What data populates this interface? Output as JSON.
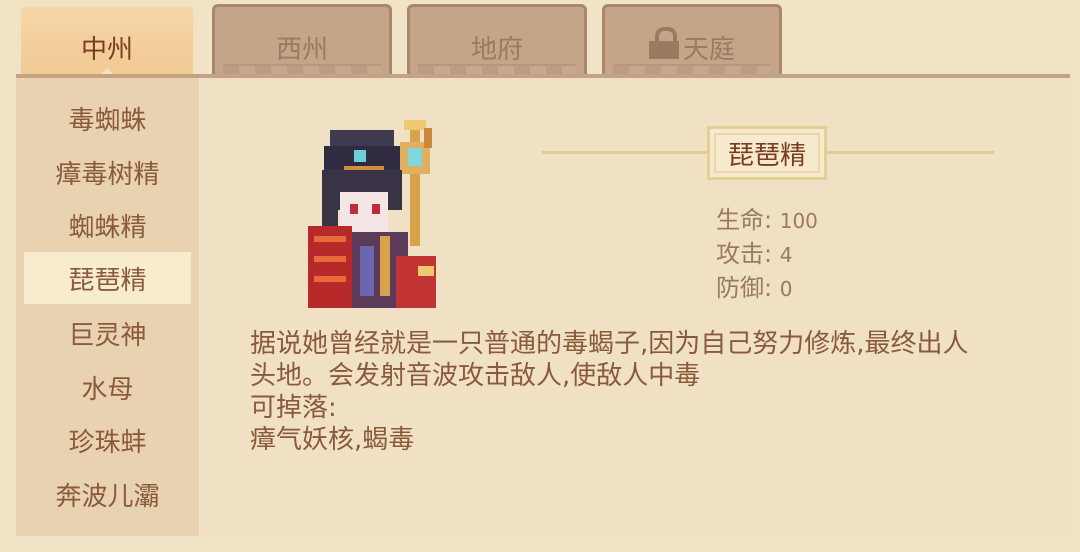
{
  "tabs": [
    {
      "label": "中州",
      "active": true,
      "locked": false
    },
    {
      "label": "西州",
      "active": false,
      "locked": false
    },
    {
      "label": "地府",
      "active": false,
      "locked": false
    },
    {
      "label": "天庭",
      "active": false,
      "locked": true
    }
  ],
  "sidebar": {
    "selected_index": 3,
    "items": [
      "毒蜘蛛",
      "瘴毒树精",
      "蜘蛛精",
      "琵琶精",
      "巨灵神",
      "水母",
      "珍珠蚌",
      "奔波儿灞"
    ]
  },
  "monster": {
    "name": "琵琶精",
    "stats": {
      "hp_label": "生命:",
      "hp_value": "100",
      "atk_label": "攻击:",
      "atk_value": "4",
      "def_label": "防御:",
      "def_value": "0"
    },
    "description": {
      "line1": "据说她曾经就是一只普通的毒蝎子,因为自己努力修炼,最终出人",
      "line2": "头地。会发射音波攻击敌人,使敌人中毒",
      "drops_label": "可掉落:",
      "drops": "瘴气妖核,蝎毒"
    }
  },
  "colors": {
    "background": "#f1e3c6",
    "sidebar": "#e8d2b0",
    "selected_item": "#f8ecce",
    "active_tab": "#f0c891",
    "inactive_tab": "#c5a488",
    "text": "#8b5a3c"
  }
}
